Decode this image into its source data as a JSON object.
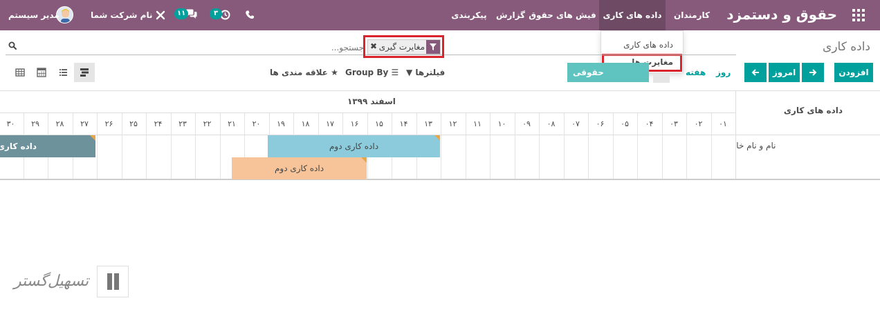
{
  "navbar": {
    "app_title": "حقوق و دستمزد",
    "menus": [
      "کارمندان",
      "داده های کاری",
      "فیش های حقوق",
      "گزارش",
      "پیکربندی"
    ],
    "company": "نام شرکت شما",
    "user": "مدیر سیستم",
    "messages_count": "۱۱",
    "activities_count": "۳"
  },
  "dropdown": {
    "items": [
      "داده های کاری",
      "مغایرت ها"
    ]
  },
  "control": {
    "breadcrumb": "داده کاری",
    "search_placeholder": "جستجو...",
    "facet_label": "مغایرت گیری",
    "btn_add": "افزودن",
    "btn_today": "امروز",
    "btn_payroll": "حقوقی",
    "link_day": "روز",
    "link_week": "هفته",
    "filters": "فیلترها",
    "group_by": "Group By",
    "favorites": "علاقه مندی ها"
  },
  "gantt": {
    "header_title": "داده های کاری",
    "month": "اسفند ۱۳۹۹",
    "days": [
      "۰۱",
      "۰۲",
      "۰۳",
      "۰۴",
      "۰۵",
      "۰۶",
      "۰۷",
      "۰۸",
      "۰۹",
      "۱۰",
      "۱۱",
      "۱۲",
      "۱۳",
      "۱۴",
      "۱۵",
      "۱۶",
      "۱۷",
      "۱۸",
      "۱۹",
      "۲۰",
      "۲۱",
      "۲۲",
      "۲۳",
      "۲۴",
      "۲۵",
      "۲۶",
      "۲۷",
      "۲۸",
      "۲۹",
      "۳۰"
    ],
    "row_label": "[نام و نام خانوادگی اول",
    "bars": [
      {
        "label": "داده کاری",
        "color": "#6e929c",
        "text_color": "#ffffff"
      },
      {
        "label": "داده کاری دوم",
        "color": "#8bcbdc",
        "text_color": "#444444"
      },
      {
        "label": "داده کاری دوم",
        "color": "#f6c498",
        "text_color": "#444444"
      }
    ]
  },
  "watermark": {
    "text": "تسهیل‌گستر"
  }
}
